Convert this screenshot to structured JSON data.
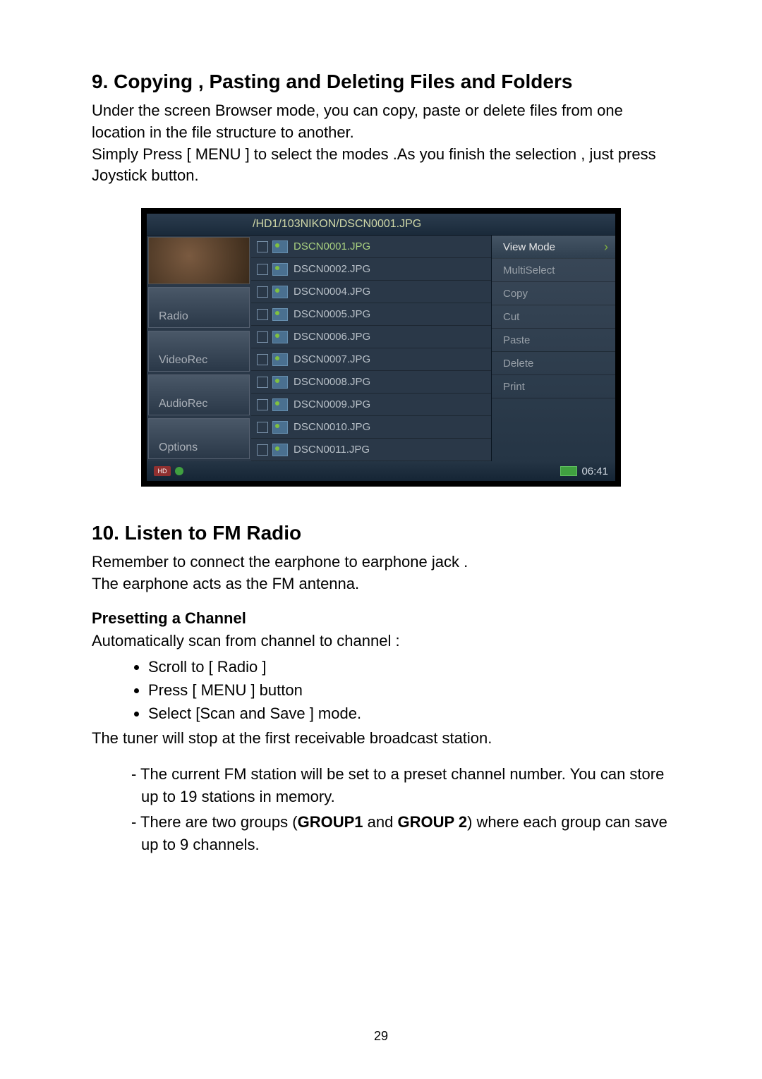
{
  "section9": {
    "heading": "9. Copying , Pasting and Deleting Files and Folders",
    "para1": "Under the screen Browser mode, you can copy, paste or delete files from one location in the file structure to another.",
    "para2": "Simply Press [ MENU ] to select the modes .As you finish the selection ,  just press Joystick button."
  },
  "screenshot": {
    "path": "/HD1/103NIKON/DSCN0001.JPG",
    "sidebar": {
      "items": [
        "Radio",
        "VideoRec",
        "AudioRec",
        "Options"
      ]
    },
    "files": [
      "DSCN0001.JPG",
      "DSCN0002.JPG",
      "DSCN0004.JPG",
      "DSCN0005.JPG",
      "DSCN0006.JPG",
      "DSCN0007.JPG",
      "DSCN0008.JPG",
      "DSCN0009.JPG",
      "DSCN0010.JPG",
      "DSCN0011.JPG"
    ],
    "menu": {
      "items": [
        "View Mode",
        "MultiSelect",
        "Copy",
        "Cut",
        "Paste",
        "Delete",
        "Print"
      ]
    },
    "status": {
      "badge": "HD",
      "time": "06:41"
    }
  },
  "section10": {
    "heading": "10. Listen to FM Radio",
    "para1": "Remember to connect the earphone to earphone jack .",
    "para2": "The earphone acts as the FM antenna.",
    "subheading": "Presetting a Channel",
    "intro": "Automatically scan from channel to channel :",
    "bullets": [
      "Scroll to [ Radio ]",
      "Press [ MENU ] button",
      "Select [Scan and Save ] mode."
    ],
    "outro": "The tuner will stop at the first receivable broadcast station.",
    "dash1_a": "- The current FM station will be set to a preset channel number. You can store up to 19 stations in memory.",
    "dash2_pre": "- There are two groups (",
    "dash2_b1": "GROUP1",
    "dash2_mid": " and ",
    "dash2_b2": "GROUP 2",
    "dash2_post": ") where each group can save up to 9 channels."
  },
  "page_number": "29"
}
